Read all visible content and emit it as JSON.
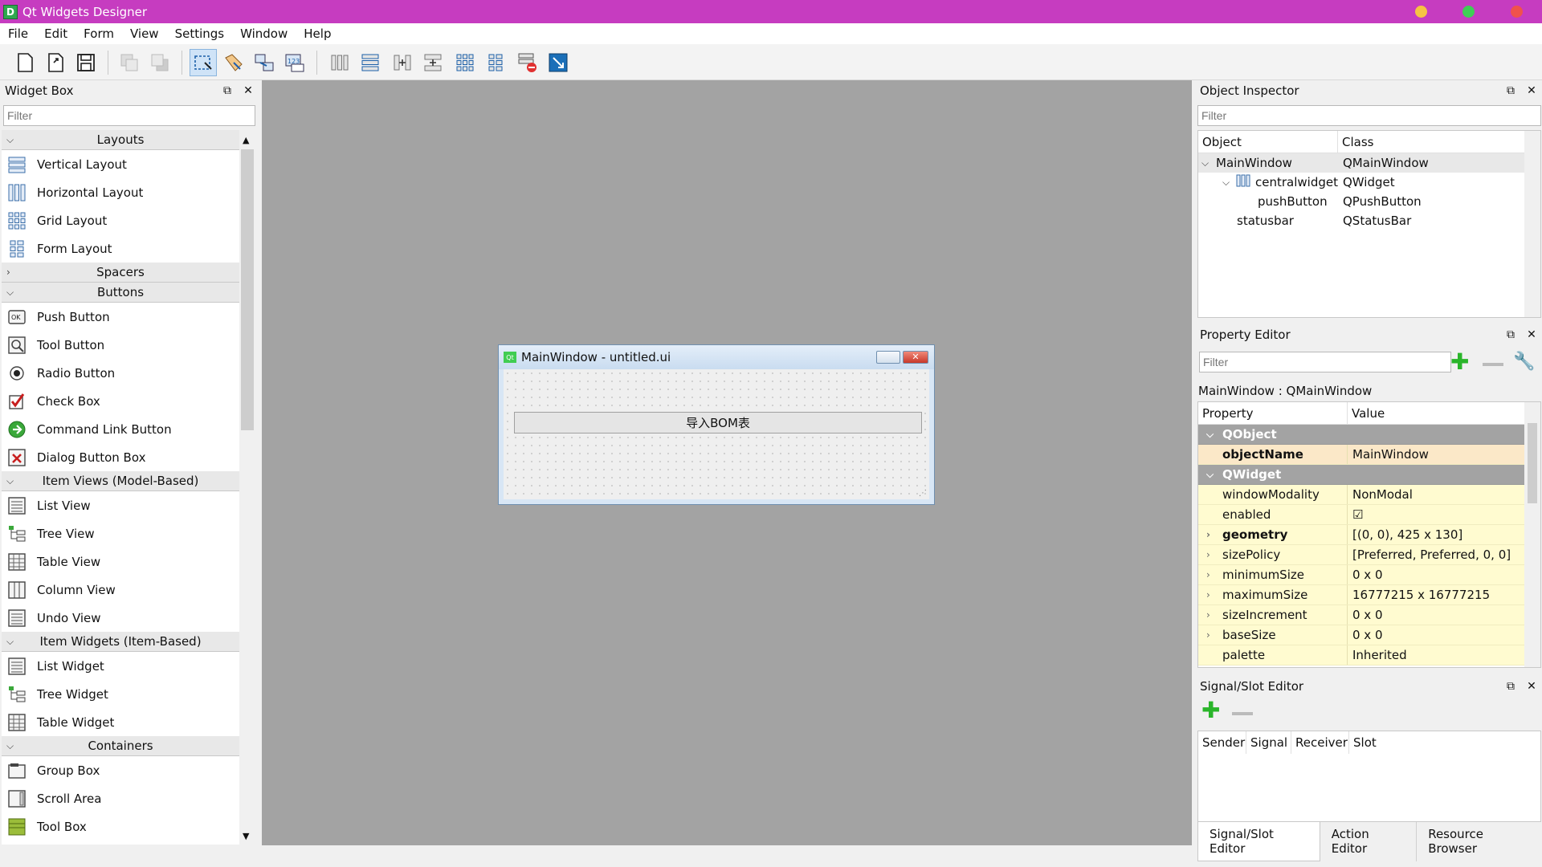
{
  "window": {
    "title": "Qt Widgets Designer",
    "icon_letter": "D"
  },
  "menubar": [
    "File",
    "Edit",
    "Form",
    "View",
    "Settings",
    "Window",
    "Help"
  ],
  "widget_box": {
    "title": "Widget Box",
    "filter_placeholder": "Filter",
    "categories": [
      {
        "name": "Layouts",
        "expanded": true,
        "items": [
          {
            "label": "Vertical Layout",
            "icon": "vertical-layout-icon"
          },
          {
            "label": "Horizontal Layout",
            "icon": "horizontal-layout-icon"
          },
          {
            "label": "Grid Layout",
            "icon": "grid-layout-icon"
          },
          {
            "label": "Form Layout",
            "icon": "form-layout-icon"
          }
        ]
      },
      {
        "name": "Spacers",
        "expanded": false,
        "items": []
      },
      {
        "name": "Buttons",
        "expanded": true,
        "items": [
          {
            "label": "Push Button",
            "icon": "push-button-icon"
          },
          {
            "label": "Tool Button",
            "icon": "tool-button-icon"
          },
          {
            "label": "Radio Button",
            "icon": "radio-button-icon"
          },
          {
            "label": "Check Box",
            "icon": "check-box-icon"
          },
          {
            "label": "Command Link Button",
            "icon": "command-link-icon"
          },
          {
            "label": "Dialog Button Box",
            "icon": "dialog-button-box-icon"
          }
        ]
      },
      {
        "name": "Item Views (Model-Based)",
        "expanded": true,
        "items": [
          {
            "label": "List View",
            "icon": "list-view-icon"
          },
          {
            "label": "Tree View",
            "icon": "tree-view-icon"
          },
          {
            "label": "Table View",
            "icon": "table-view-icon"
          },
          {
            "label": "Column View",
            "icon": "column-view-icon"
          },
          {
            "label": "Undo View",
            "icon": "undo-view-icon"
          }
        ]
      },
      {
        "name": "Item Widgets (Item-Based)",
        "expanded": true,
        "items": [
          {
            "label": "List Widget",
            "icon": "list-widget-icon"
          },
          {
            "label": "Tree Widget",
            "icon": "tree-widget-icon"
          },
          {
            "label": "Table Widget",
            "icon": "table-widget-icon"
          }
        ]
      },
      {
        "name": "Containers",
        "expanded": true,
        "items": [
          {
            "label": "Group Box",
            "icon": "group-box-icon"
          },
          {
            "label": "Scroll Area",
            "icon": "scroll-area-icon"
          },
          {
            "label": "Tool Box",
            "icon": "tool-box-icon"
          }
        ]
      }
    ]
  },
  "form": {
    "title": "MainWindow - untitled.ui",
    "button_text": "导入BOM表"
  },
  "object_inspector": {
    "title": "Object Inspector",
    "filter_placeholder": "Filter",
    "columns": [
      "Object",
      "Class"
    ],
    "rows": [
      {
        "object": "MainWindow",
        "class": "QMainWindow",
        "depth": 0,
        "expand": "open",
        "selected": true
      },
      {
        "object": "centralwidget",
        "class": "QWidget",
        "depth": 1,
        "expand": "open",
        "selected": false
      },
      {
        "object": "pushButton",
        "class": "QPushButton",
        "depth": 2,
        "expand": "none",
        "selected": false
      },
      {
        "object": "statusbar",
        "class": "QStatusBar",
        "depth": 1,
        "expand": "none",
        "selected": false
      }
    ]
  },
  "property_editor": {
    "title": "Property Editor",
    "filter_placeholder": "Filter",
    "context": "MainWindow : QMainWindow",
    "columns": [
      "Property",
      "Value"
    ],
    "rows": [
      {
        "type": "group",
        "name": "QObject"
      },
      {
        "type": "prop",
        "name": "objectName",
        "value": "MainWindow",
        "bold": true,
        "selected": true,
        "expandable": false
      },
      {
        "type": "group",
        "name": "QWidget"
      },
      {
        "type": "prop",
        "name": "windowModality",
        "value": "NonModal",
        "bold": false,
        "expandable": false
      },
      {
        "type": "prop",
        "name": "enabled",
        "value": "☑",
        "bold": false,
        "expandable": false
      },
      {
        "type": "prop",
        "name": "geometry",
        "value": "[(0, 0), 425 x 130]",
        "bold": true,
        "expandable": true
      },
      {
        "type": "prop",
        "name": "sizePolicy",
        "value": "[Preferred, Preferred, 0, 0]",
        "bold": false,
        "expandable": true
      },
      {
        "type": "prop",
        "name": "minimumSize",
        "value": "0 x 0",
        "bold": false,
        "expandable": true
      },
      {
        "type": "prop",
        "name": "maximumSize",
        "value": "16777215 x 16777215",
        "bold": false,
        "expandable": true
      },
      {
        "type": "prop",
        "name": "sizeIncrement",
        "value": "0 x 0",
        "bold": false,
        "expandable": true
      },
      {
        "type": "prop",
        "name": "baseSize",
        "value": "0 x 0",
        "bold": false,
        "expandable": true
      },
      {
        "type": "prop",
        "name": "palette",
        "value": "Inherited",
        "bold": false,
        "expandable": false
      }
    ]
  },
  "signal_slot": {
    "title": "Signal/Slot Editor",
    "columns": [
      "Sender",
      "Signal",
      "Receiver",
      "Slot"
    ],
    "tabs": [
      "Signal/Slot Editor",
      "Action Editor",
      "Resource Browser"
    ],
    "active_tab": 0
  },
  "colors": {
    "titlebar": "#c63cc0",
    "group_row": "#a3a3a3",
    "prop_row": "#fffbd0",
    "canvas": "#a3a3a3",
    "min_dot": "#f6c343",
    "max_dot": "#3fce55",
    "close_dot": "#f0524c"
  }
}
